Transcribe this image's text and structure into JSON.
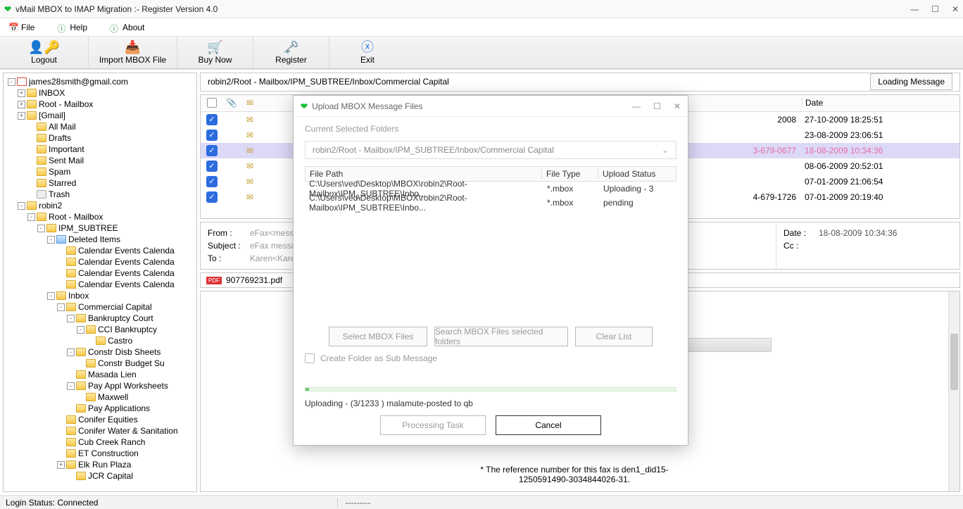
{
  "window": {
    "title": "vMail MBOX to IMAP Migration :- Register Version 4.0"
  },
  "menu": {
    "file": "File",
    "help": "Help",
    "about": "About"
  },
  "toolbar": {
    "logout": "Logout",
    "import": "Import MBOX File",
    "buy": "Buy Now",
    "register": "Register",
    "exit": "Exit"
  },
  "tree": [
    {
      "ind": 0,
      "t": "-",
      "icon": "gmail",
      "label": "james28smith@gmail.com"
    },
    {
      "ind": 1,
      "t": "+",
      "icon": "open",
      "label": "INBOX"
    },
    {
      "ind": 1,
      "t": "+",
      "icon": "open",
      "label": "Root - Mailbox"
    },
    {
      "ind": 1,
      "t": "+",
      "icon": "open",
      "label": "[Gmail]"
    },
    {
      "ind": 2,
      "t": "",
      "icon": "closed",
      "label": "All Mail"
    },
    {
      "ind": 2,
      "t": "",
      "icon": "closed",
      "label": "Drafts"
    },
    {
      "ind": 2,
      "t": "",
      "icon": "closed",
      "label": "Important"
    },
    {
      "ind": 2,
      "t": "",
      "icon": "closed",
      "label": "Sent Mail"
    },
    {
      "ind": 2,
      "t": "",
      "icon": "closed",
      "label": "Spam"
    },
    {
      "ind": 2,
      "t": "",
      "icon": "closed",
      "label": "Starred"
    },
    {
      "ind": 2,
      "t": "",
      "icon": "trash",
      "label": "Trash"
    },
    {
      "ind": 1,
      "t": "-",
      "icon": "open",
      "label": "robin2"
    },
    {
      "ind": 2,
      "t": "-",
      "icon": "open",
      "label": "Root - Mailbox"
    },
    {
      "ind": 3,
      "t": "-",
      "icon": "open",
      "label": "IPM_SUBTREE"
    },
    {
      "ind": 4,
      "t": "-",
      "icon": "blue",
      "label": "Deleted Items"
    },
    {
      "ind": 5,
      "t": "",
      "icon": "closed",
      "label": "Calendar Events Calenda"
    },
    {
      "ind": 5,
      "t": "",
      "icon": "closed",
      "label": "Calendar Events Calenda"
    },
    {
      "ind": 5,
      "t": "",
      "icon": "closed",
      "label": "Calendar Events Calenda"
    },
    {
      "ind": 5,
      "t": "",
      "icon": "closed",
      "label": "Calendar Events Calenda"
    },
    {
      "ind": 4,
      "t": "-",
      "icon": "open",
      "label": "Inbox"
    },
    {
      "ind": 5,
      "t": "-",
      "icon": "open",
      "label": "Commercial Capital"
    },
    {
      "ind": 6,
      "t": "-",
      "icon": "open",
      "label": "Bankruptcy Court"
    },
    {
      "ind": 7,
      "t": "-",
      "icon": "open",
      "label": "CCI Bankruptcy"
    },
    {
      "ind": 8,
      "t": "",
      "icon": "closed",
      "label": "Castro"
    },
    {
      "ind": 6,
      "t": "-",
      "icon": "open",
      "label": "Constr Disb Sheets"
    },
    {
      "ind": 7,
      "t": "",
      "icon": "closed",
      "label": "Constr Budget Su"
    },
    {
      "ind": 6,
      "t": "",
      "icon": "closed",
      "label": "Masada Lien"
    },
    {
      "ind": 6,
      "t": "-",
      "icon": "open",
      "label": "Pay Appl Worksheets"
    },
    {
      "ind": 7,
      "t": "",
      "icon": "closed",
      "label": "Maxwell"
    },
    {
      "ind": 6,
      "t": "",
      "icon": "closed",
      "label": "Pay Applications"
    },
    {
      "ind": 5,
      "t": "",
      "icon": "closed",
      "label": "Conifer Equities"
    },
    {
      "ind": 5,
      "t": "",
      "icon": "closed",
      "label": "Conifer Water & Sanitation"
    },
    {
      "ind": 5,
      "t": "",
      "icon": "closed",
      "label": "Cub Creek Ranch"
    },
    {
      "ind": 5,
      "t": "",
      "icon": "closed",
      "label": "ET Construction"
    },
    {
      "ind": 5,
      "t": "+",
      "icon": "open",
      "label": "Elk Run Plaza"
    },
    {
      "ind": 6,
      "t": "",
      "icon": "closed",
      "label": "JCR Capital"
    }
  ],
  "path": "robin2/Root - Mailbox/IPM_SUBTREE/Inbox/Commercial Capital",
  "loading_btn": "Loading Message",
  "cols": {
    "date": "Date"
  },
  "messages": [
    {
      "chk": true,
      "sel": false,
      "subj_tail": "2008",
      "date": "27-10-2009 18:25:51"
    },
    {
      "chk": true,
      "sel": false,
      "subj_tail": "",
      "date": "23-08-2009 23:06:51"
    },
    {
      "chk": true,
      "sel": true,
      "subj_tail": "3-679-0677",
      "date": "18-08-2009 10:34:36"
    },
    {
      "chk": true,
      "sel": false,
      "subj_tail": "",
      "date": "08-06-2009 20:52:01"
    },
    {
      "chk": true,
      "sel": false,
      "subj_tail": "",
      "date": "07-01-2009 21:06:54"
    },
    {
      "chk": true,
      "sel": false,
      "subj_tail": "4-679-1726",
      "date": "07-01-2009 20:19:40"
    }
  ],
  "detail": {
    "from_k": "From :",
    "from_v": "eFax<message@i",
    "subj_k": "Subject :",
    "subj_v": "eFax message fr",
    "to_k": "To :",
    "to_v": "Karen<Karen@ma",
    "date_k": "Date :",
    "date_v": "18-08-2009 10:34:36",
    "cc_k": "Cc :",
    "cc_v": ""
  },
  "attachment": {
    "name": "907769231.pdf"
  },
  "content": {
    "ref1": "* The reference number for this fax is den1_did15-",
    "ref2": "1250591490-3034844026-31."
  },
  "modal": {
    "title": "Upload MBOX Message Files",
    "sel_lbl": "Current Selected Folders",
    "sel_path": "robin2/Root - Mailbox/IPM_SUBTREE/Inbox/Commercial Capital",
    "th1": "File Path",
    "th2": "File Type",
    "th3": "Upload Status",
    "rows": [
      {
        "p": "C:\\Users\\ved\\Desktop\\MBOX\\robin2\\Root-Mailbox\\IPM_SUBTREE\\Inbo...",
        "t": "*.mbox",
        "s": "Uploading - 3"
      },
      {
        "p": "C:\\Users\\ved\\Desktop\\MBOX\\robin2\\Root-Mailbox\\IPM_SUBTREE\\Inbo...",
        "t": "*.mbox",
        "s": "pending"
      }
    ],
    "btn_select": "Select MBOX Files",
    "btn_search": "Search MBOX Files selected folders",
    "btn_clear": "Clear List",
    "chk_sub": "Create Folder as Sub Message",
    "status": "Uploading - (3/1233 ) malamute-posted to qb",
    "btn_proc": "Processing Task",
    "btn_cancel": "Cancel"
  },
  "statusbar": {
    "login": "Login Status: Connected",
    "dash": "---------"
  }
}
